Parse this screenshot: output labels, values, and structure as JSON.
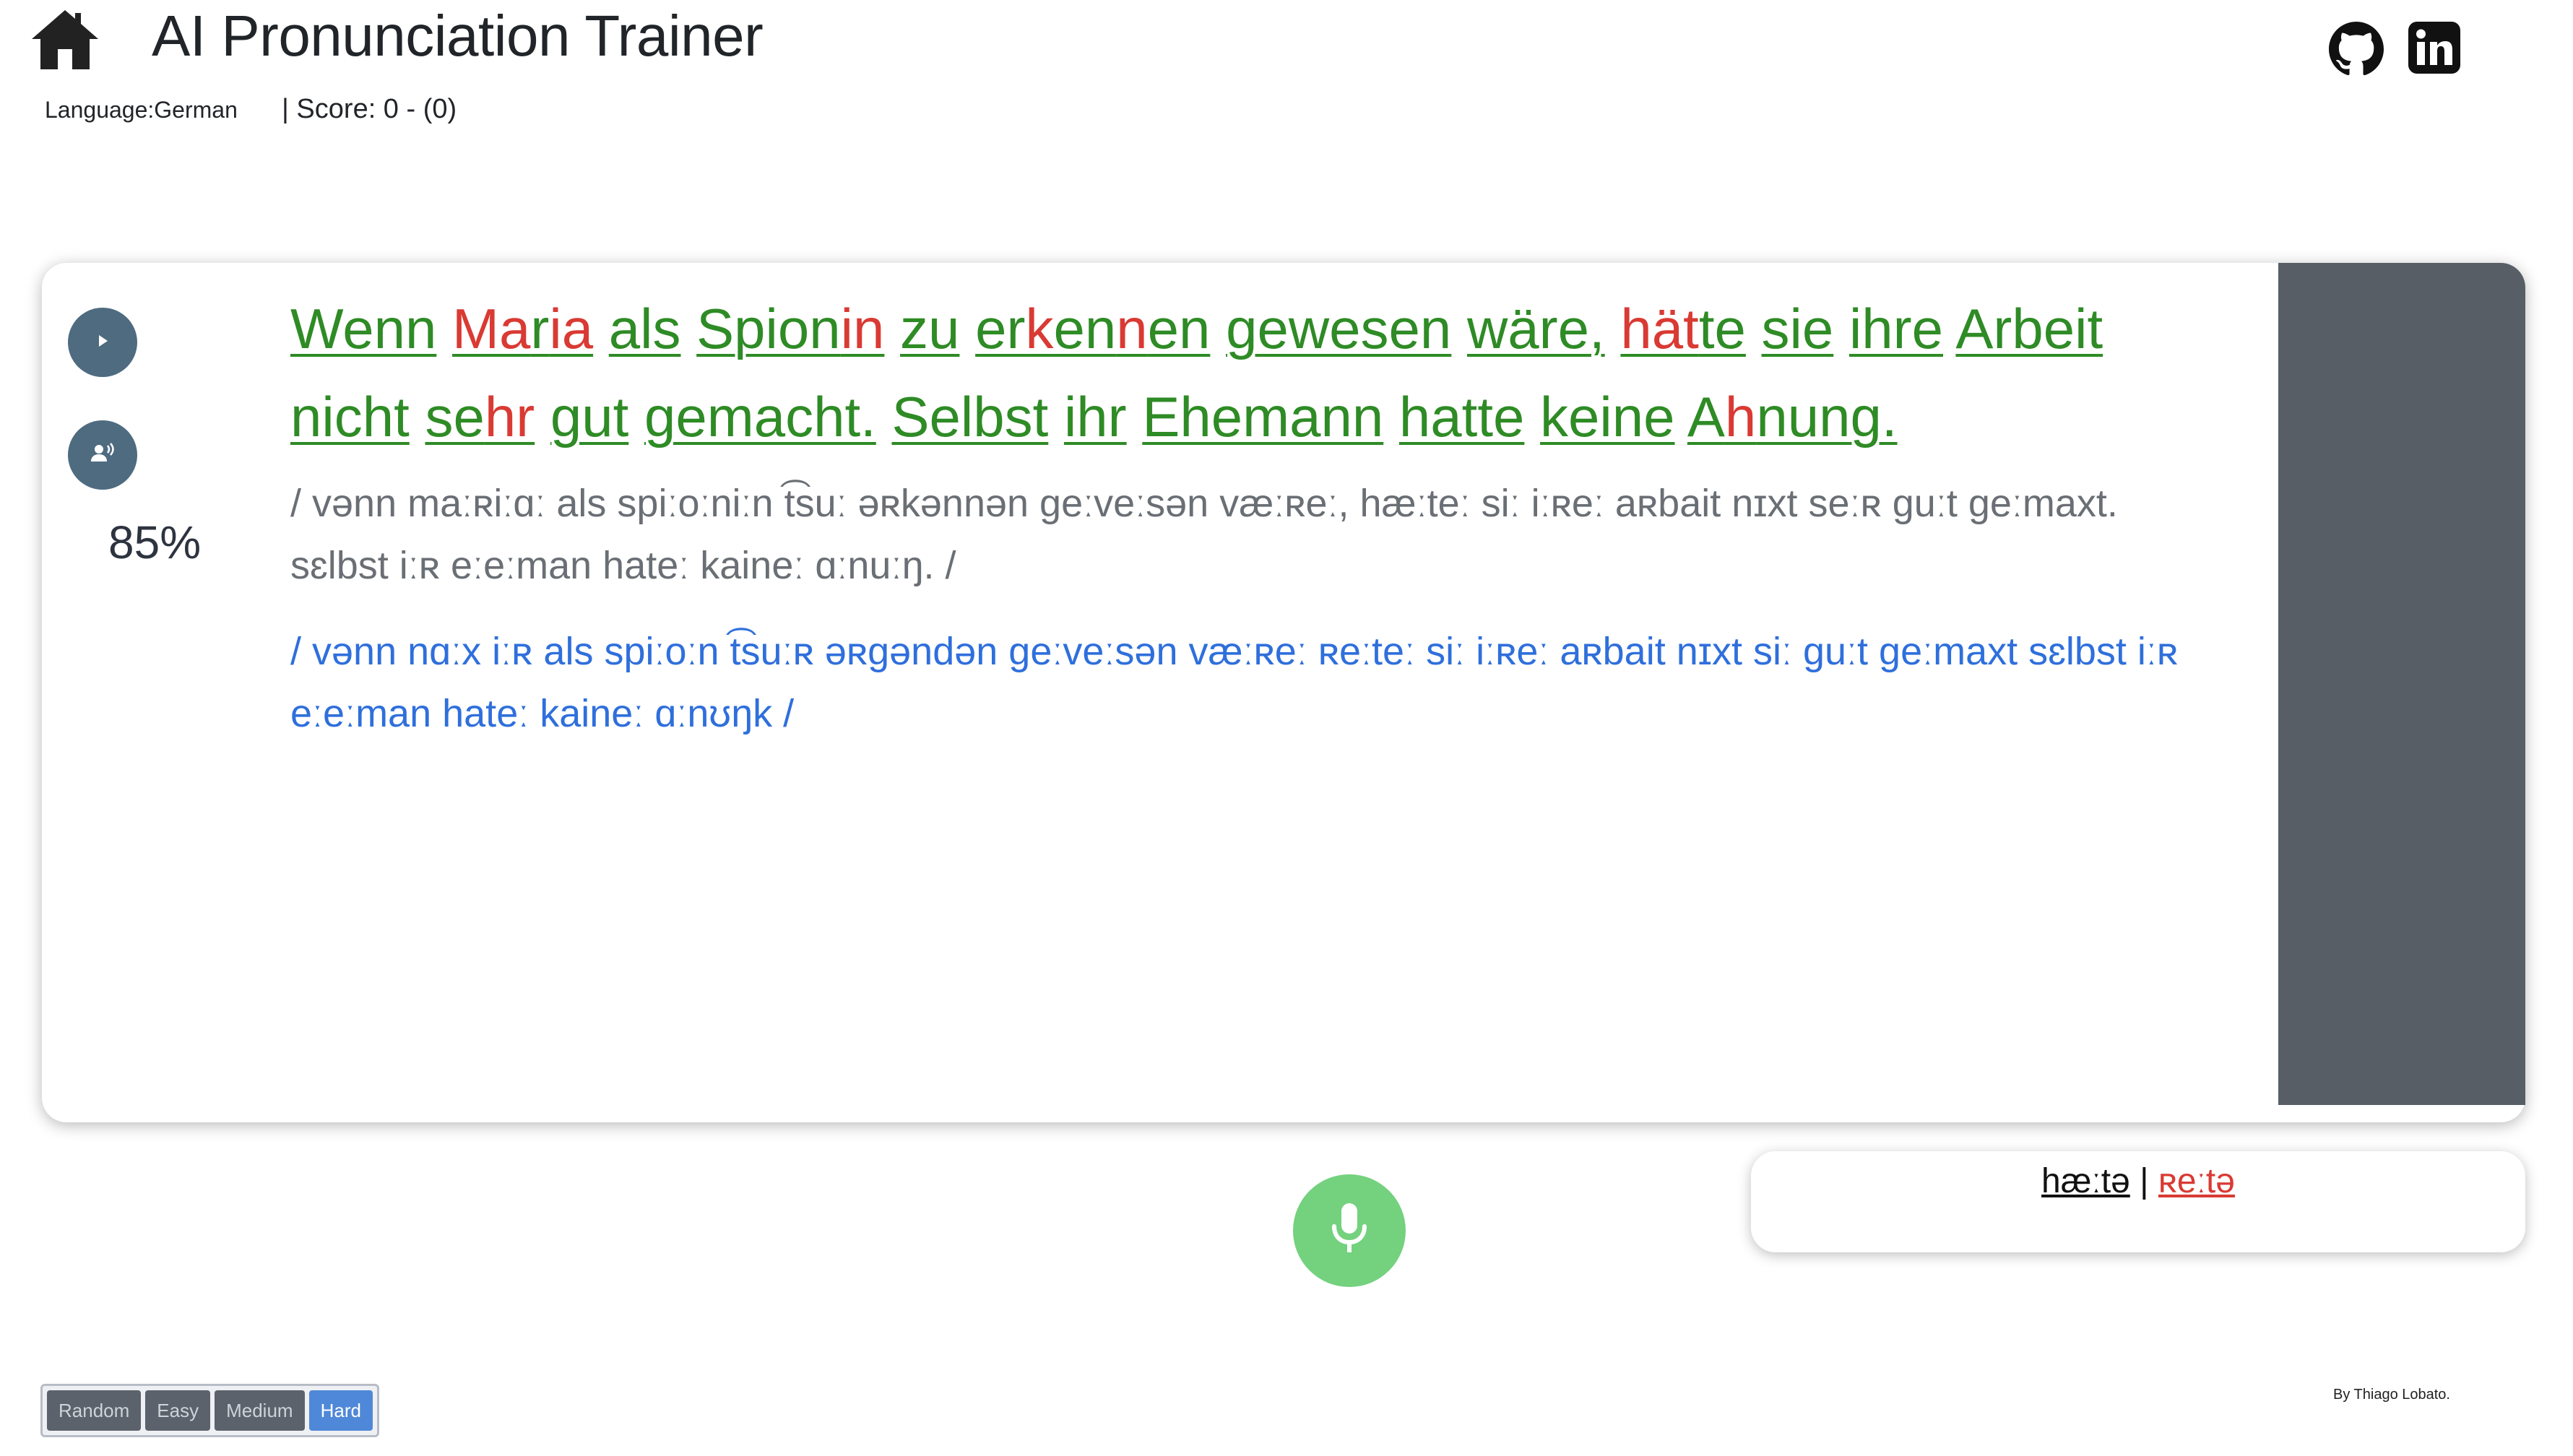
{
  "header": {
    "title": "AI Pronunciation Trainer",
    "language_label": "Language:",
    "language_value": "German",
    "score_text": "| Score: 0 - (0)"
  },
  "icons": {
    "home": "home-icon",
    "github": "github-icon",
    "linkedin": "linkedin-icon",
    "play": "play-icon",
    "listen": "voice-playback-icon",
    "mic": "microphone-icon"
  },
  "main": {
    "accuracy": "85%",
    "sentence_words": [
      [
        {
          "t": "Wenn",
          "c": "g"
        }
      ],
      [
        {
          "t": "Ma",
          "c": "r"
        },
        {
          "t": "r",
          "c": "g"
        },
        {
          "t": "ia",
          "c": "r"
        }
      ],
      [
        {
          "t": "als",
          "c": "g"
        }
      ],
      [
        {
          "t": "Spion",
          "c": "g"
        },
        {
          "t": "in",
          "c": "r"
        }
      ],
      [
        {
          "t": "zu",
          "c": "g"
        }
      ],
      [
        {
          "t": "er",
          "c": "g"
        },
        {
          "t": "k",
          "c": "r"
        },
        {
          "t": "en",
          "c": "g"
        },
        {
          "t": "n",
          "c": "r"
        },
        {
          "t": "en",
          "c": "g"
        }
      ],
      [
        {
          "t": "gewesen",
          "c": "g"
        }
      ],
      [
        {
          "t": "wäre,",
          "c": "g"
        }
      ],
      [
        {
          "t": "hät",
          "c": "r"
        },
        {
          "t": "te",
          "c": "g"
        }
      ],
      [
        {
          "t": "sie",
          "c": "g"
        }
      ],
      [
        {
          "t": "ihre",
          "c": "g"
        }
      ],
      [
        {
          "t": "Arbeit",
          "c": "g"
        }
      ],
      [
        {
          "t": "nicht",
          "c": "g"
        }
      ],
      [
        {
          "t": "se",
          "c": "g"
        },
        {
          "t": "hr",
          "c": "r"
        }
      ],
      [
        {
          "t": "gut",
          "c": "g"
        }
      ],
      [
        {
          "t": "gemacht.",
          "c": "g"
        }
      ],
      [
        {
          "t": "Selbst",
          "c": "g"
        }
      ],
      [
        {
          "t": "ihr",
          "c": "g"
        }
      ],
      [
        {
          "t": "Ehemann",
          "c": "g"
        }
      ],
      [
        {
          "t": "hatte",
          "c": "g"
        }
      ],
      [
        {
          "t": "keine",
          "c": "g"
        }
      ],
      [
        {
          "t": "A",
          "c": "g"
        },
        {
          "t": "h",
          "c": "r"
        },
        {
          "t": "nung.",
          "c": "g"
        }
      ]
    ],
    "ipa_reference": "/ vənn maːʀiːɑː als spiːoːniːn t͡suː əʀkənnən geːveːsən væːʀeː, hæːteː siː iːʀeː aʀbait nɪxt seːʀ guːt geːmaxt. sɛlbst iːʀ eːeːman hateː kaineː ɑːnuːŋ. /",
    "ipa_recorded": "/ vənn nɑːx iːʀ als spiːoːn t͡suːʀ əʀgəndən geːveːsən væːʀeː ʀeːteː siː iːʀeː aʀbait nɪxt siː guːt geːmaxt sɛlbst iːʀ eːeːman hateː kaineː ɑːnʊŋk /"
  },
  "compare": {
    "reference": "hæːtə",
    "separator": " | ",
    "recorded": "ʀeːtə"
  },
  "difficulty": {
    "buttons": [
      "Random",
      "Easy",
      "Medium",
      "Hard"
    ],
    "selected": "Hard"
  },
  "footer": {
    "credit": "By Thiago Lobato."
  },
  "colors": {
    "correct": "#2e8b25",
    "incorrect": "#d93a33",
    "recorded_ipa": "#2f6fdc",
    "side_panel": "#585e66",
    "mic": "#74d17e"
  }
}
